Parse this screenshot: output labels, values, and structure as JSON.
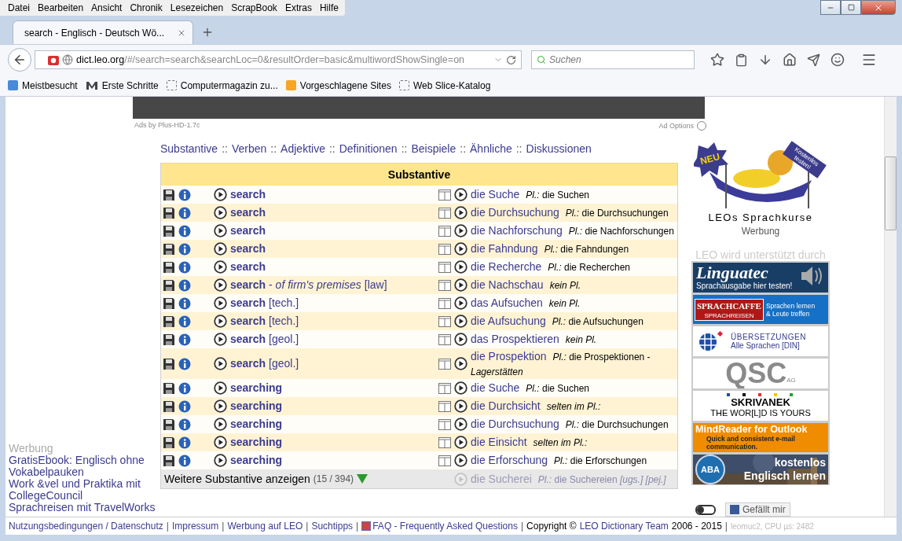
{
  "menu": [
    "Datei",
    "Bearbeiten",
    "Ansicht",
    "Chronik",
    "Lesezeichen",
    "ScrapBook",
    "Extras",
    "Hilfe"
  ],
  "tab": {
    "title": "search - Englisch - Deutsch Wö..."
  },
  "address": {
    "host": "dict.leo.org",
    "path": "/#/search=search&searchLoc=0&resultOrder=basic&multiwordShowSingle=on"
  },
  "search": {
    "placeholder": "Suchen"
  },
  "bookmarks": [
    {
      "label": "Meistbesucht",
      "kind": "mostvisited"
    },
    {
      "label": "Erste Schritte",
      "kind": "m"
    },
    {
      "label": "Computermagazin zu...",
      "kind": "slice"
    },
    {
      "label": "Vorgeschlagene Sites",
      "kind": "suggested"
    },
    {
      "label": "Web Slice-Katalog",
      "kind": "slice"
    }
  ],
  "ad_caption": {
    "left": "Ads by Plus-HD-1.7c",
    "right": "Ad Options"
  },
  "section_links": [
    {
      "kind": "link",
      "text": "Substantive"
    },
    {
      "kind": "sep",
      "text": "::"
    },
    {
      "kind": "link",
      "text": "Verben"
    },
    {
      "kind": "sep",
      "text": "::"
    },
    {
      "kind": "link",
      "text": "Adjektive"
    },
    {
      "kind": "sep",
      "text": "::"
    },
    {
      "kind": "link",
      "text": "Definitionen"
    },
    {
      "kind": "sep",
      "text": "::"
    },
    {
      "kind": "link",
      "text": "Beispiele"
    },
    {
      "kind": "sep",
      "text": "::"
    },
    {
      "kind": "link",
      "text": "Ähnliche"
    },
    {
      "kind": "sep",
      "text": "::"
    },
    {
      "kind": "link",
      "text": "Diskussionen"
    }
  ],
  "table": {
    "title": "Substantive",
    "rows": [
      {
        "en": "**search**",
        "de": "die Suche",
        "de_note": "*Pl.:* die Suchen"
      },
      {
        "en": "**search**",
        "de": "die Durchsuchung",
        "de_note": "*Pl.:* die Durchsuchungen"
      },
      {
        "en": "**search**",
        "de": "die Nachforschung",
        "de_note": "*Pl.:* die Nachforschungen"
      },
      {
        "en": "**search**",
        "de": "die Fahndung",
        "de_note": "*Pl.:* die Fahndungen"
      },
      {
        "en": "**search**",
        "de": "die Recherche",
        "de_note": "*Pl.:* die Recherchen"
      },
      {
        "en": "**search**   - *of firm's premises* [law]",
        "de": "die Nachschau",
        "de_note": "*kein Pl.*"
      },
      {
        "en": "**search** [tech.]",
        "de": "das Aufsuchen",
        "de_note": "*kein Pl.*"
      },
      {
        "en": "**search** [tech.]",
        "de": "die Aufsuchung",
        "de_note": "*Pl.:* die Aufsuchungen"
      },
      {
        "en": "**search** [geol.]",
        "de": "das Prospektieren",
        "de_note": "*kein Pl.*"
      },
      {
        "en": "**search** [geol.]",
        "de": "die Prospektion",
        "de_note": "*Pl.:* die Prospektionen   - *Lagerstätten*"
      },
      {
        "en": "**searching**",
        "de": "die Suche",
        "de_note": "*Pl.:* die Suchen"
      },
      {
        "en": "**searching**",
        "de": "die Durchsicht",
        "de_note": "*selten im Pl.:*"
      },
      {
        "en": "**searching**",
        "de": "die Durchsuchung",
        "de_note": "*Pl.:* die Durchsuchungen"
      },
      {
        "en": "**searching**",
        "de": "die Einsicht",
        "de_note": "*selten im Pl.:*"
      },
      {
        "en": "**searching**",
        "de": "die Erforschung",
        "de_note": "*Pl.:* die Erforschungen"
      }
    ],
    "more": {
      "label": "Weitere Substantive anzeigen",
      "count": "(15 / 394)"
    },
    "faded_row": {
      "de": "die Sucherei",
      "de_note": "*Pl.:* die Suchereien *[ugs.] [pej.]*"
    }
  },
  "left_ads": {
    "caption": "Werbung",
    "links": [
      "GratisEbook: Englisch ohne Vokabelpauken",
      "Work &vel und Praktika mit CollegeCouncil",
      "Sprachreisen mit TravelWorks"
    ]
  },
  "promo": {
    "badge": "NEU",
    "ribbon": "Kostenlos testen!",
    "title": "LEOs Sprachkurse",
    "caption": "Werbung"
  },
  "sponsors": {
    "caption": "LEO wird unterstützt durch",
    "ads": [
      {
        "kind": "linguatec",
        "lines": [
          "Linguatec",
          "Sprachausgabe hier testen!"
        ]
      },
      {
        "kind": "sprachcaffe",
        "lines": [
          "SPRACHCAFFE",
          "SPRACHREISEN",
          "Sprachen lernen",
          "& Leute treffen"
        ]
      },
      {
        "kind": "translation",
        "lines": [
          "ÜBERSETZUNGEN",
          "Alle Sprachen [DIN]"
        ]
      },
      {
        "kind": "qsc",
        "lines": [
          "QSC",
          "AG"
        ]
      },
      {
        "kind": "skrivanek",
        "lines": [
          "SKRIVANEK",
          "THE WOR[L]D IS YOURS"
        ]
      },
      {
        "kind": "mindreader",
        "lines": [
          "MindReader for Outlook",
          "Quick and consistent e-mail communication."
        ]
      },
      {
        "kind": "aba",
        "lines": [
          "ABA",
          "kostenlos",
          "Englisch lernen"
        ]
      }
    ]
  },
  "like": {
    "label": "Gefällt mir",
    "toggle_on": false
  },
  "footer": [
    {
      "kind": "link",
      "text": "Nutzungsbedingungen / Datenschutz"
    },
    {
      "kind": "sep",
      "text": "|"
    },
    {
      "kind": "link",
      "text": "Impressum"
    },
    {
      "kind": "sep",
      "text": "|"
    },
    {
      "kind": "link",
      "text": "Werbung auf LEO"
    },
    {
      "kind": "sep",
      "text": "|"
    },
    {
      "kind": "link",
      "text": "Suchtipps"
    },
    {
      "kind": "sep",
      "text": "|"
    },
    {
      "kind": "faq",
      "text": "FAQ - Frequently Asked Questions"
    },
    {
      "kind": "sep",
      "text": "|"
    },
    {
      "kind": "plain",
      "text": "Copyright ©"
    },
    {
      "kind": "link",
      "text": "LEO Dictionary Team"
    },
    {
      "kind": "plain",
      "text": "2006 - 2015"
    },
    {
      "kind": "sep",
      "text": "|"
    },
    {
      "kind": "faint",
      "text": "leomuc2, CPU µs: 2482"
    }
  ]
}
